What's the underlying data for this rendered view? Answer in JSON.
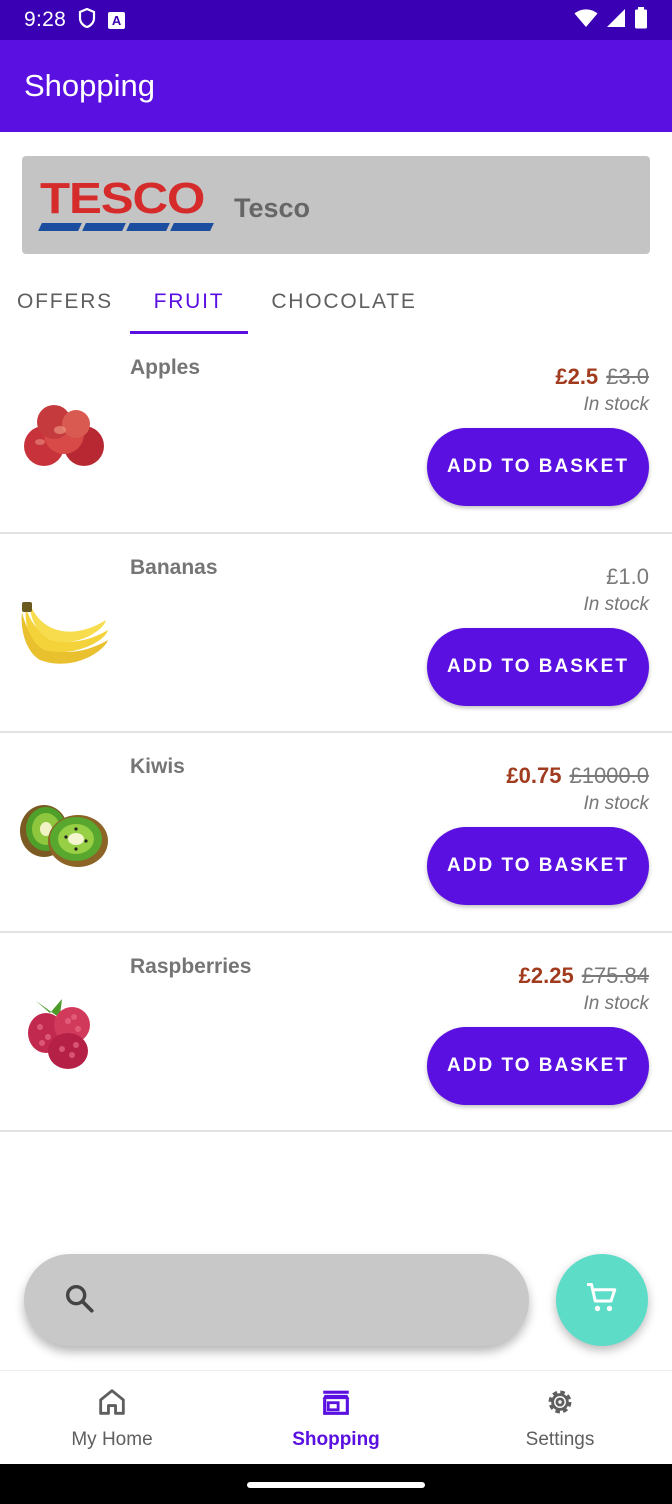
{
  "status_bar": {
    "time": "9:28",
    "notification_letter": "A"
  },
  "app_bar": {
    "title": "Shopping"
  },
  "store": {
    "logo_text": "TESCO",
    "name": "Tesco"
  },
  "tabs": [
    {
      "label": "OFFERS",
      "active": false
    },
    {
      "label": "FRUIT",
      "active": true
    },
    {
      "label": "CHOCOLATE",
      "active": false
    }
  ],
  "products": [
    {
      "name": "Apples",
      "price": "£2.5",
      "old_price": "£3.0",
      "stock": "In stock",
      "button": "ADD TO BASKET",
      "image_icon": "apples-image"
    },
    {
      "name": "Bananas",
      "price": "£1.0",
      "old_price": "",
      "stock": "In stock",
      "button": "ADD TO BASKET",
      "image_icon": "bananas-image"
    },
    {
      "name": "Kiwis",
      "price": "£0.75",
      "old_price": "£1000.0",
      "stock": "In stock",
      "button": "ADD TO BASKET",
      "image_icon": "kiwis-image"
    },
    {
      "name": "Raspberries",
      "price": "£2.25",
      "old_price": "£75.84",
      "stock": "In stock",
      "button": "ADD TO BASKET",
      "image_icon": "raspberries-image"
    }
  ],
  "search": {
    "placeholder": "",
    "value": ""
  },
  "bottom_nav": [
    {
      "label": "My Home",
      "icon": "home-icon",
      "active": false
    },
    {
      "label": "Shopping",
      "icon": "store-icon",
      "active": true
    },
    {
      "label": "Settings",
      "icon": "gear-icon",
      "active": false
    }
  ],
  "colors": {
    "primary": "#5a10e0",
    "status_bar": "#3a00b3",
    "sale_price": "#a13b1e",
    "fab": "#5ddcc7",
    "tesco_red": "#d62b2b",
    "tesco_blue": "#1c4ea0"
  }
}
